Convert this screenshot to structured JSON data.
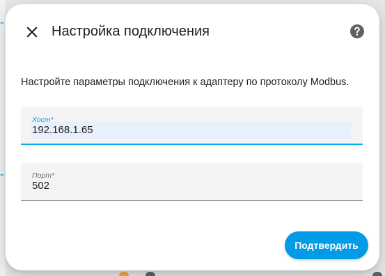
{
  "dialog": {
    "title": "Настройка подключения",
    "description": "Настройте параметры подключения к адаптеру по протоколу Modbus.",
    "close_icon": "close-icon",
    "help_icon": "help-icon"
  },
  "fields": {
    "host": {
      "label": "Хост*",
      "value": "192.168.1.65"
    },
    "port": {
      "label": "Порт*",
      "value": "502"
    }
  },
  "actions": {
    "confirm_label": "Подтвердить"
  },
  "colors": {
    "accent": "#039be5",
    "autofill": "#e8f0fe",
    "field_bg": "#f4f4f4"
  }
}
